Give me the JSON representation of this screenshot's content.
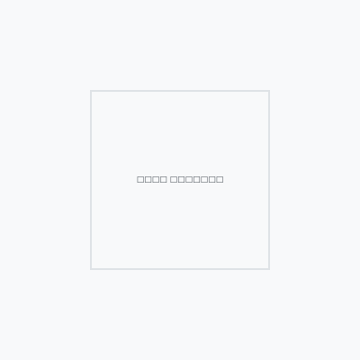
{
  "frame": {
    "text": "□□□□ □□□□□□□"
  },
  "colors": {
    "background": "#f8f9fa",
    "frame_border": "#dee2e6",
    "text": "#495057"
  }
}
